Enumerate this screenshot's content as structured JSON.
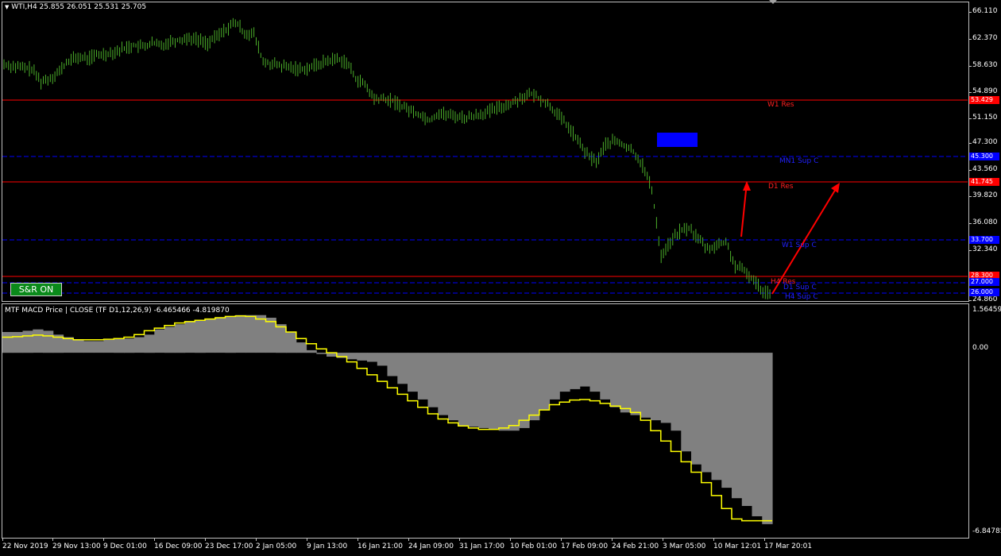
{
  "header": {
    "symbol_line": "WTI,H4  25.855 26.051 25.531 25.705",
    "menu_icon": "triangle-down-icon"
  },
  "indicator": {
    "title": "MTF MACD Price | CLOSE  (TF D1,12,26,9) -6.465466 -4.819870",
    "axis_top": "1.56459",
    "axis_zero": "0.00",
    "axis_bottom": "-6.84785"
  },
  "button": {
    "label": "S&R  ON"
  },
  "price_axis": [
    "66.110",
    "62.370",
    "58.630",
    "54.890",
    "51.150",
    "47.300",
    "43.560",
    "39.820",
    "36.080",
    "32.340",
    "24.860"
  ],
  "price_tags": [
    {
      "label": "53.429",
      "color": "#ff0000"
    },
    {
      "label": "45.300",
      "color": "#0000ff"
    },
    {
      "label": "41.745",
      "color": "#ff0000"
    },
    {
      "label": "33.700",
      "color": "#0000ff"
    },
    {
      "label": "28.300",
      "color": "#ff0000"
    },
    {
      "label": "27.000",
      "color": "#0000ff"
    },
    {
      "label": "26.000",
      "color": "#0000ff"
    }
  ],
  "levels": [
    {
      "label": "W1 Res",
      "color": "#ff2020"
    },
    {
      "label": "MN1 Sup C",
      "color": "#2020ff"
    },
    {
      "label": "D1 Res",
      "color": "#ff2020"
    },
    {
      "label": "W1 Sup C",
      "color": "#2020ff"
    },
    {
      "label": "H4 Res",
      "color": "#ff2020"
    },
    {
      "label": "D1 Sup C",
      "color": "#2020ff"
    },
    {
      "label": "H4 Sup C",
      "color": "#2020ff"
    }
  ],
  "time_axis": [
    "22 Nov 2019",
    "29 Nov 13:00",
    "9 Dec 01:00",
    "16 Dec 09:00",
    "23 Dec 17:00",
    "2 Jan 05:00",
    "9 Jan 13:00",
    "16 Jan 21:00",
    "24 Jan 09:00",
    "31 Jan 17:00",
    "10 Feb 01:00",
    "17 Feb 09:00",
    "24 Feb 21:00",
    "3 Mar 05:00",
    "10 Mar 12:01",
    "17 Mar 20:01"
  ],
  "colors": {
    "candles": "#4caf2a",
    "macd_hist": "#808080",
    "signal": "#ffff00",
    "resistance": "#ff0000",
    "support": "#0000ff",
    "arrow": "#ff0000"
  },
  "chart_data": {
    "type": "line",
    "price_series": {
      "name": "",
      "values": [
        58.5,
        58.2,
        58.0,
        57.8,
        56.0,
        56.5,
        57.5,
        59.0,
        59.5,
        59.3,
        59.8,
        60.0,
        60.3,
        60.8,
        61.2,
        61.0,
        61.5,
        61.2,
        61.8,
        62.0,
        62.3,
        62.0,
        61.5,
        62.5,
        63.5,
        64.5,
        63.0,
        62.8,
        58.8,
        58.5,
        58.2,
        58.0,
        57.8,
        58.0,
        58.5,
        59.0,
        59.3,
        58.8,
        56.5,
        55.5,
        53.5,
        53.5,
        53.2,
        52.5,
        51.8,
        51.2,
        50.5,
        51.5,
        51.2,
        51.0,
        50.8,
        51.2,
        51.5,
        52.0,
        52.5,
        53.0,
        53.8,
        54.2,
        53.5,
        52.5,
        51.0,
        49.5,
        47.5,
        45.5,
        44.5,
        47.0,
        47.5,
        46.8,
        46.0,
        44.0,
        40.5,
        31.0,
        33.0,
        34.5,
        35.0,
        33.5,
        32.0,
        32.5,
        33.0,
        29.5,
        28.8,
        27.5,
        26.0,
        25.7
      ],
      "ylim": [
        24.86,
        66.11
      ]
    },
    "macd": {
      "ylim": [
        -6.84785,
        1.56459
      ],
      "histogram": [
        0.8,
        0.8,
        0.85,
        0.9,
        0.85,
        0.7,
        0.6,
        0.5,
        0.45,
        0.45,
        0.5,
        0.55,
        0.55,
        0.6,
        0.7,
        0.9,
        1.0,
        1.1,
        1.2,
        1.25,
        1.3,
        1.35,
        1.4,
        1.45,
        1.45,
        1.45,
        1.35,
        1.1,
        0.8,
        0.4,
        0.1,
        -0.05,
        -0.15,
        -0.2,
        -0.25,
        -0.3,
        -0.35,
        -0.5,
        -0.9,
        -1.2,
        -1.5,
        -1.8,
        -2.1,
        -2.4,
        -2.6,
        -2.8,
        -2.85,
        -2.9,
        -2.95,
        -3.0,
        -3.0,
        -2.9,
        -2.6,
        -2.2,
        -1.8,
        -1.5,
        -1.4,
        -1.3,
        -1.5,
        -1.8,
        -2.1,
        -2.3,
        -2.4,
        -2.5,
        -2.6,
        -2.7,
        -3.0,
        -3.8,
        -4.3,
        -4.6,
        -4.9,
        -5.2,
        -5.6,
        -5.9,
        -6.3,
        -6.6
      ],
      "signal": [
        0.6,
        0.62,
        0.65,
        0.68,
        0.65,
        0.6,
        0.55,
        0.5,
        0.5,
        0.5,
        0.52,
        0.55,
        0.6,
        0.7,
        0.85,
        0.95,
        1.05,
        1.15,
        1.2,
        1.25,
        1.3,
        1.35,
        1.4,
        1.42,
        1.4,
        1.3,
        1.2,
        1.0,
        0.8,
        0.55,
        0.35,
        0.15,
        0.0,
        -0.15,
        -0.35,
        -0.6,
        -0.85,
        -1.1,
        -1.35,
        -1.6,
        -1.85,
        -2.1,
        -2.35,
        -2.55,
        -2.7,
        -2.82,
        -2.9,
        -2.95,
        -2.95,
        -2.9,
        -2.8,
        -2.6,
        -2.4,
        -2.2,
        -2.0,
        -1.9,
        -1.82,
        -1.8,
        -1.85,
        -1.95,
        -2.05,
        -2.15,
        -2.3,
        -2.6,
        -3.0,
        -3.4,
        -3.8,
        -4.2,
        -4.6,
        -5.0,
        -5.5,
        -6.0,
        -6.4,
        -6.47,
        -6.47,
        -6.47
      ]
    }
  }
}
